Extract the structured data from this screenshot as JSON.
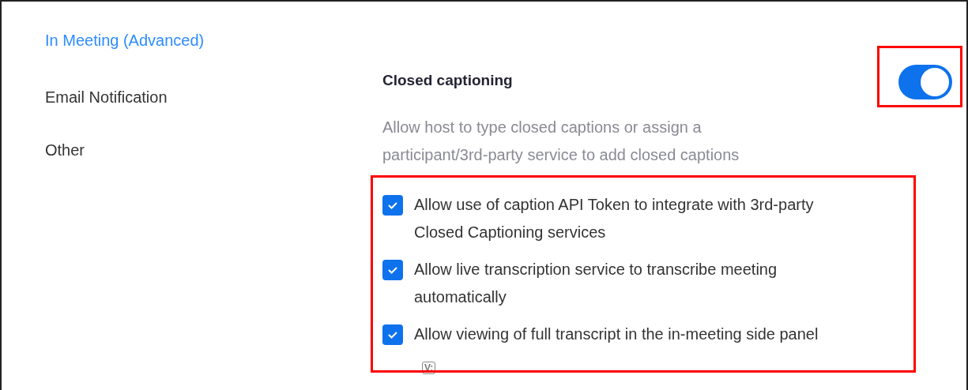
{
  "sidebar": {
    "items": [
      {
        "label": "In Meeting (Advanced)",
        "selected": true
      },
      {
        "label": "Email Notification",
        "selected": false
      },
      {
        "label": "Other",
        "selected": false
      }
    ]
  },
  "setting": {
    "title": "Closed captioning",
    "on": true,
    "description": "Allow host to type closed captions or assign a participant/3rd-party service to add closed captions",
    "options": [
      {
        "label": "Allow use of caption API Token to integrate with 3rd-party Closed Captioning services",
        "checked": true
      },
      {
        "label": "Allow live transcription service to transcribe meeting automatically",
        "checked": true
      },
      {
        "label": "Allow viewing of full transcript in the in-meeting side panel",
        "checked": true
      }
    ],
    "badge": "V:"
  }
}
